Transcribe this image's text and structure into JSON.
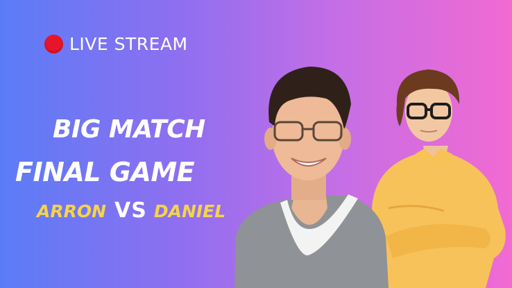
{
  "live_badge": {
    "text": "LIVE STREAM",
    "dot_color": "#e8152a",
    "icon": "record-dot-icon"
  },
  "headline": {
    "line1": "BIG MATCH",
    "line2": "FINAL GAME"
  },
  "matchup": {
    "player1": "ARRON",
    "versus": "VS",
    "player2": "DANIEL",
    "name_color": "#f5d44a"
  },
  "background": {
    "gradient_start": "#5b7cf6",
    "gradient_end": "#f26ad2"
  }
}
